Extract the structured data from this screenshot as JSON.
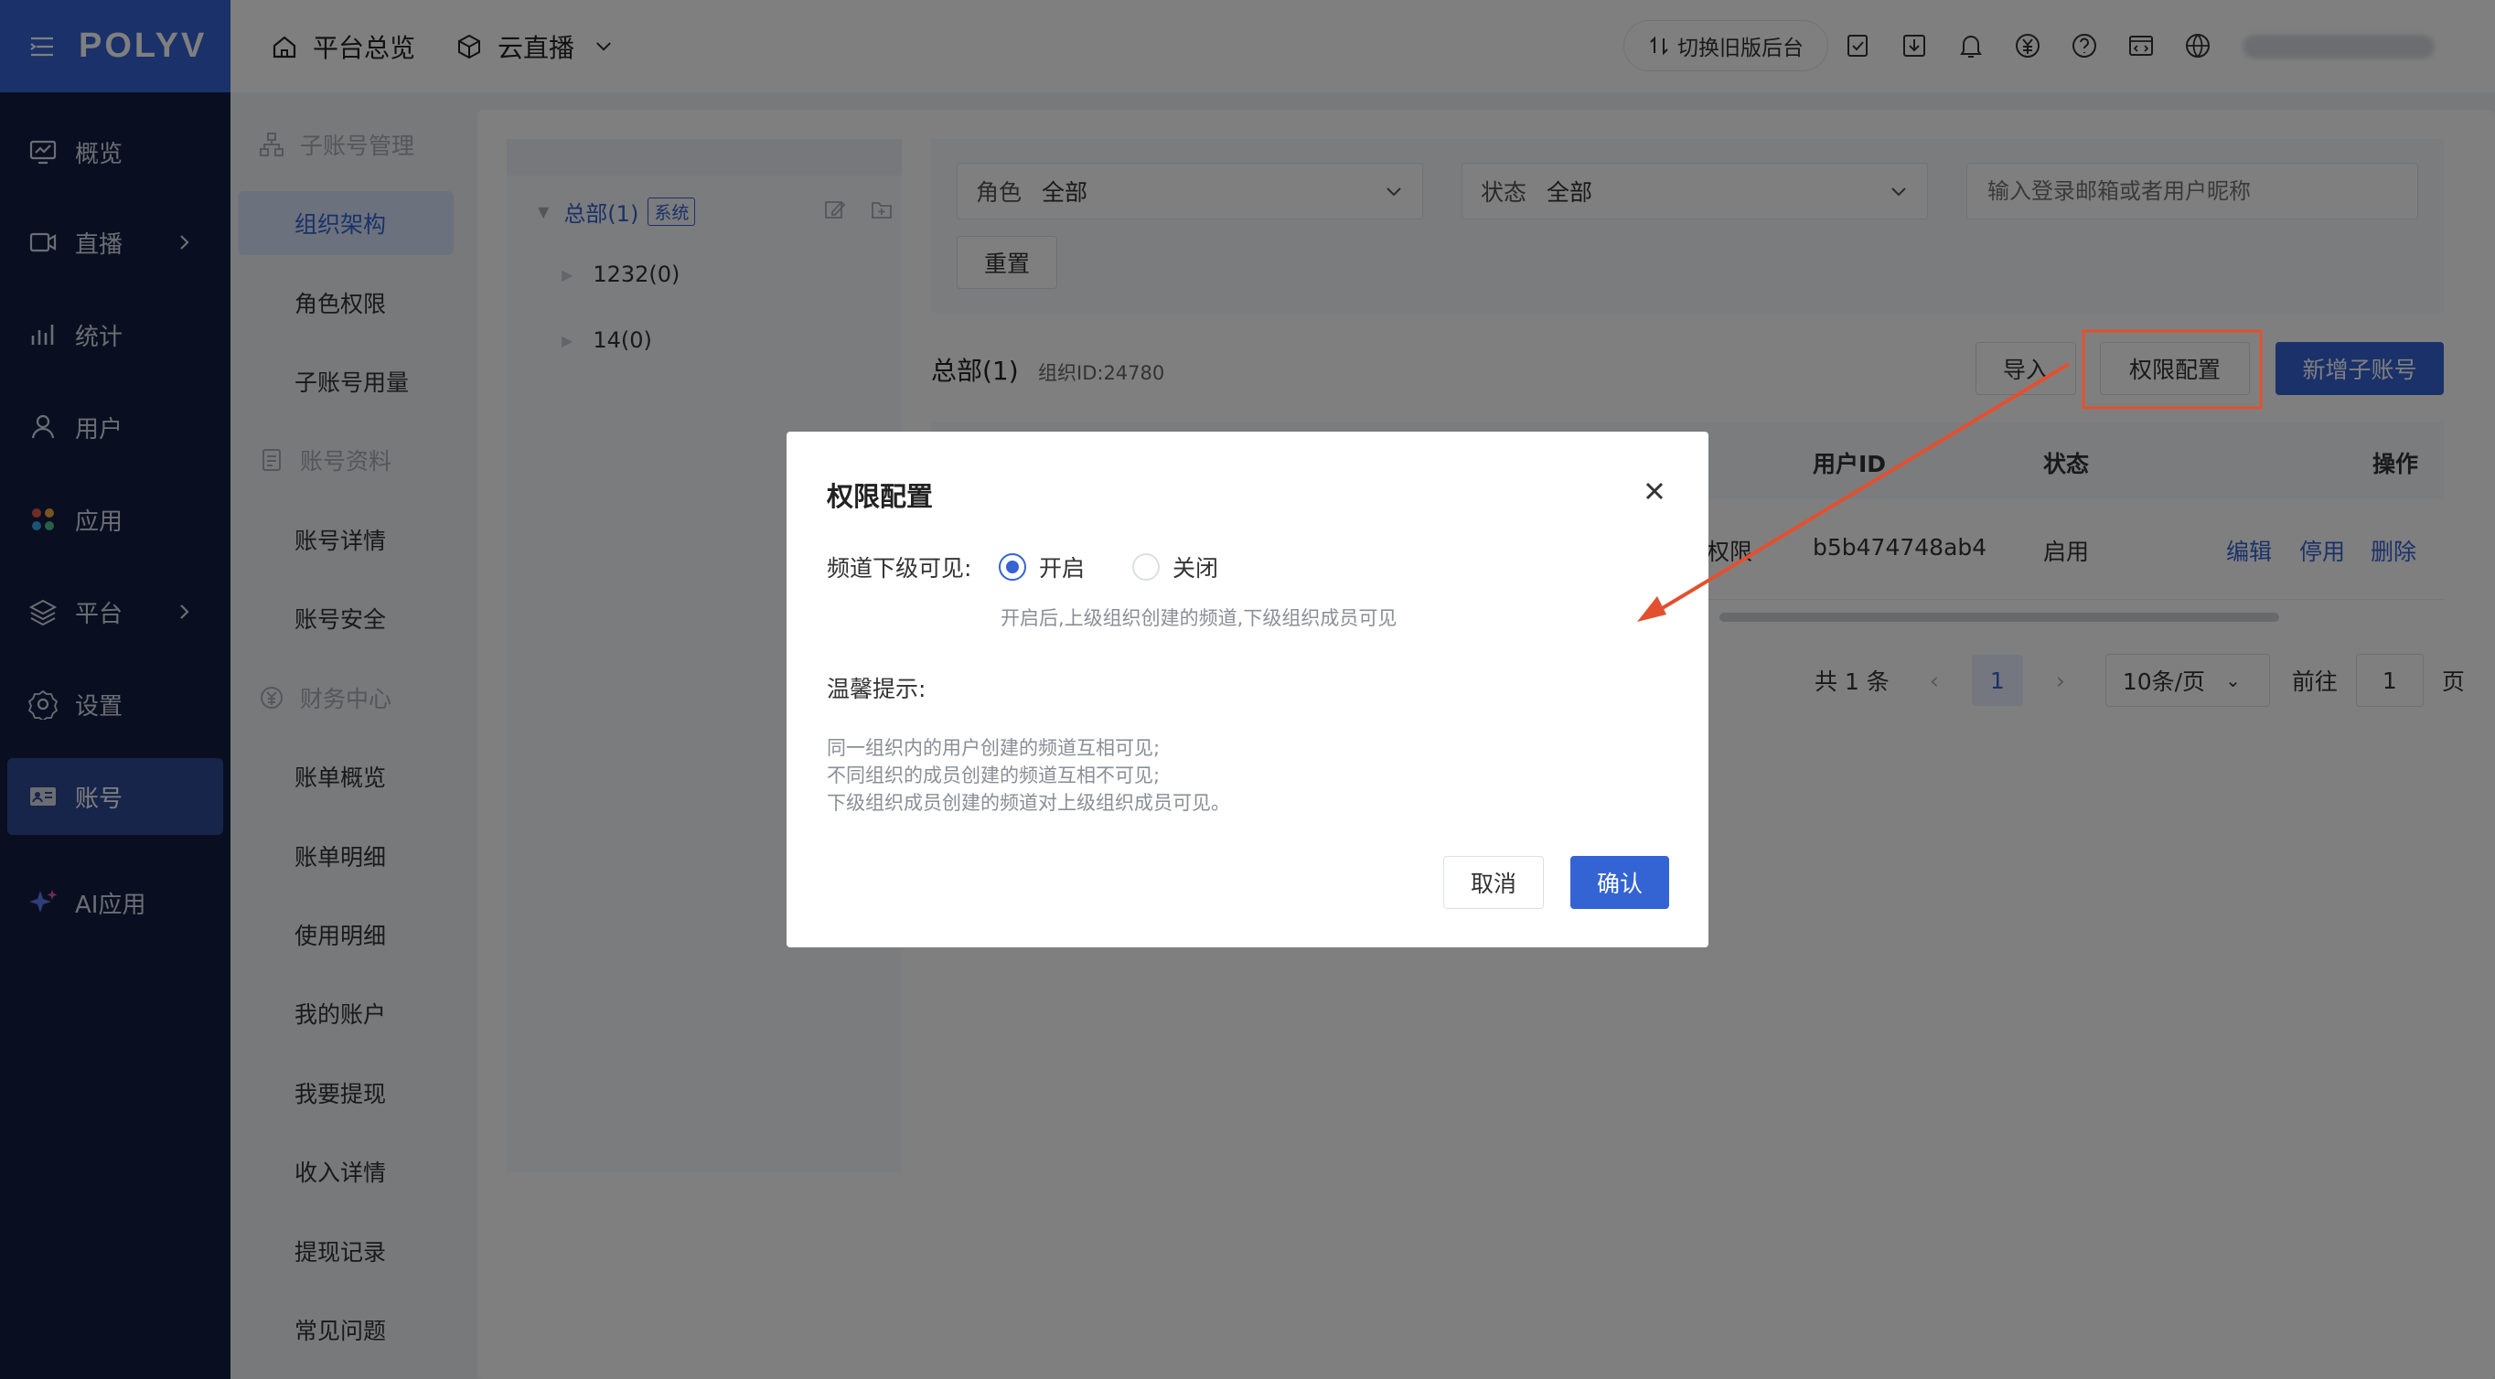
{
  "app": {
    "logo": "POLYV"
  },
  "sidebar": {
    "items": [
      {
        "label": "概览"
      },
      {
        "label": "直播"
      },
      {
        "label": "统计"
      },
      {
        "label": "用户"
      },
      {
        "label": "应用"
      },
      {
        "label": "平台"
      },
      {
        "label": "设置"
      },
      {
        "label": "账号"
      },
      {
        "label": "AI应用"
      }
    ]
  },
  "subnav": {
    "groups": [
      {
        "title": "子账号管理",
        "items": [
          "组织架构",
          "角色权限",
          "子账号用量"
        ]
      },
      {
        "title": "账号资料",
        "items": [
          "账号详情",
          "账号安全"
        ]
      },
      {
        "title": "财务中心",
        "items": [
          "账单概览",
          "账单明细",
          "使用明细",
          "我的账户",
          "我要提现",
          "收入详情",
          "提现记录",
          "常见问题"
        ]
      }
    ]
  },
  "topbar": {
    "overview": "平台总览",
    "product": "云直播",
    "switch_label": "切换旧版后台"
  },
  "tree": {
    "root": "总部(1)",
    "root_tag": "系统",
    "children": [
      "1232(0)",
      "14(0)"
    ]
  },
  "filters": {
    "role_label": "角色",
    "role_value": "全部",
    "status_label": "状态",
    "status_value": "全部",
    "search_placeholder": "输入登录邮箱或者用户昵称",
    "reset": "重置"
  },
  "org": {
    "name": "总部(1)",
    "id_text": "组织ID:24780",
    "import": "导入",
    "permission": "权限配置",
    "add": "新增子账号"
  },
  "table": {
    "headers": {
      "user_id": "用户ID",
      "status": "状态",
      "actions": "操作"
    },
    "row": {
      "partial": "权限",
      "user_id": "b5b474748ab4",
      "status": "启用",
      "edit": "编辑",
      "disable": "停用",
      "delete": "删除"
    }
  },
  "pager": {
    "total": "共 1 条",
    "page": "1",
    "size": "10条/页",
    "goto": "前往",
    "goto_value": "1",
    "page_unit": "页"
  },
  "modal": {
    "title": "权限配置",
    "field_label": "频道下级可见:",
    "option_on": "开启",
    "option_off": "关闭",
    "hint": "开启后,上级组织创建的频道,下级组织成员可见",
    "tip_title": "温馨提示:",
    "tips": [
      "同一组织内的用户创建的频道互相可见;",
      "不同组织的成员创建的频道互相不可见;",
      "下级组织成员创建的频道对上级组织成员可见。"
    ],
    "cancel": "取消",
    "confirm": "确认",
    "selected": "开启"
  },
  "colors": {
    "brand": "#3463d4",
    "sidebar": "#131f42",
    "annotation": "#e2502f"
  }
}
